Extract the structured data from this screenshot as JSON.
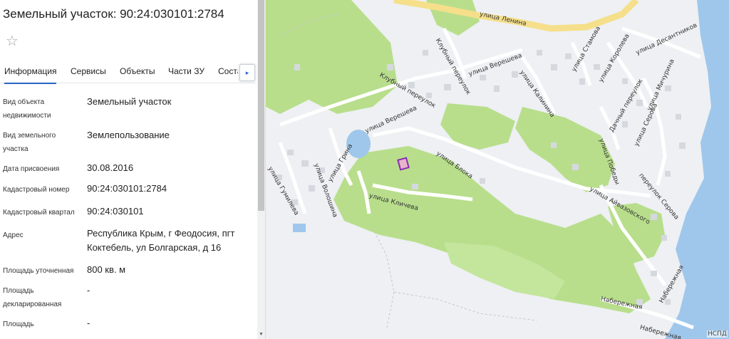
{
  "header": {
    "title": "Земельный участок: 90:24:030101:2784"
  },
  "tabs": [
    {
      "label": "Информация"
    },
    {
      "label": "Сервисы"
    },
    {
      "label": "Объекты"
    },
    {
      "label": "Части ЗУ"
    },
    {
      "label": "Соста"
    }
  ],
  "tab_next_symbol": "▸",
  "star_symbol": "☆",
  "fields": [
    {
      "label": "Вид объекта недвижимости",
      "value": "Земельный участок"
    },
    {
      "label": "Вид земельного участка",
      "value": "Землепользование"
    },
    {
      "label": "Дата присвоения",
      "value": "30.08.2016"
    },
    {
      "label": "Кадастровый номер",
      "value": "90:24:030101:2784"
    },
    {
      "label": "Кадастровый квартал",
      "value": "90:24:030101"
    },
    {
      "label": "Адрес",
      "value": "Республика Крым, г Феодосия, пгт Коктебель, ул Болгарская, д 16"
    },
    {
      "label": "Площадь уточненная",
      "value": "800 кв. м"
    },
    {
      "label": "Площадь декларированная",
      "value": "-"
    },
    {
      "label": "Площадь",
      "value": "-"
    }
  ],
  "map": {
    "streets": [
      "улица Ленина",
      "Клубный переулок",
      "Клубный переулок",
      "улица Верешева",
      "улица Калинина",
      "улица Стамова",
      "улица Королева",
      "улица Десантников",
      "улица Мичурина",
      "Дачный переулок",
      "улица Серова",
      "улица Победы",
      "переулок Серова",
      "улица Верешева",
      "улица Блока",
      "улица Айвазовского",
      "улица Гумилева",
      "улица Волошина",
      "улица Грина",
      "улица Кличева",
      "Набережная",
      "Набережная",
      "Набережная"
    ],
    "corner_text": "НСПД",
    "colors": {
      "green": "#b8de8c",
      "water": "#9fc7ec",
      "road": "#ffffff",
      "main_road": "#f5df8a",
      "background": "#eef0f3",
      "parcel": "#8b2bb3"
    }
  }
}
